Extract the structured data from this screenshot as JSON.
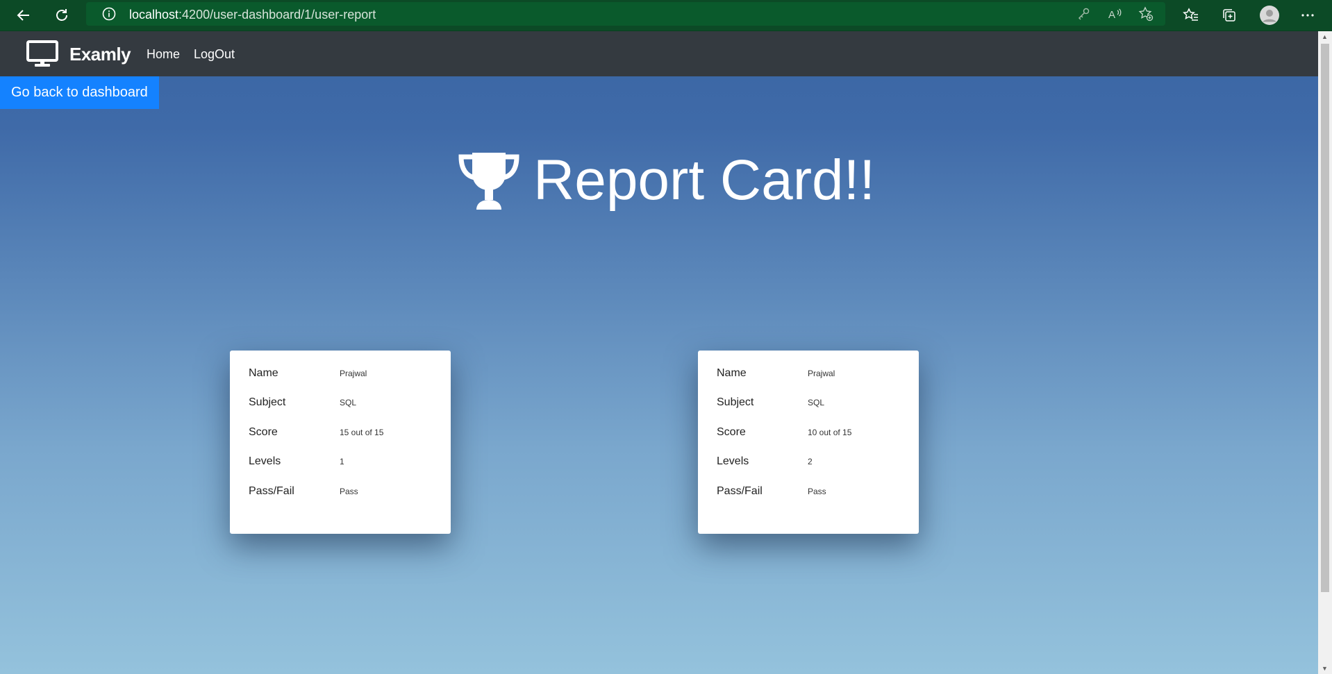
{
  "browser": {
    "url_host": "localhost",
    "url_rest": ":4200/user-dashboard/1/user-report"
  },
  "navbar": {
    "brand": "Examly",
    "links": [
      "Home",
      "LogOut"
    ]
  },
  "back_button": "Go back to dashboard",
  "title": "Report Card!!",
  "cards": [
    {
      "rows": [
        {
          "label": "Name",
          "value": "Prajwal"
        },
        {
          "label": "Subject",
          "value": "SQL"
        },
        {
          "label": "Score",
          "value": "15 out of 15"
        },
        {
          "label": "Levels",
          "value": "1"
        },
        {
          "label": "Pass/Fail",
          "value": "Pass"
        }
      ]
    },
    {
      "rows": [
        {
          "label": "Name",
          "value": "Prajwal"
        },
        {
          "label": "Subject",
          "value": "SQL"
        },
        {
          "label": "Score",
          "value": "10 out of 15"
        },
        {
          "label": "Levels",
          "value": "2"
        },
        {
          "label": "Pass/Fail",
          "value": "Pass"
        }
      ]
    }
  ],
  "colors": {
    "navbar": "#343a40",
    "button": "#1482ff",
    "browser_theme": "#0c4a26"
  },
  "icons": [
    "back-arrow-icon",
    "refresh-icon",
    "info-icon",
    "key-icon",
    "read-aloud-icon",
    "add-favorite-icon",
    "favorites-icon",
    "collections-icon",
    "profile-icon",
    "more-icon",
    "monitor-icon",
    "trophy-icon"
  ]
}
